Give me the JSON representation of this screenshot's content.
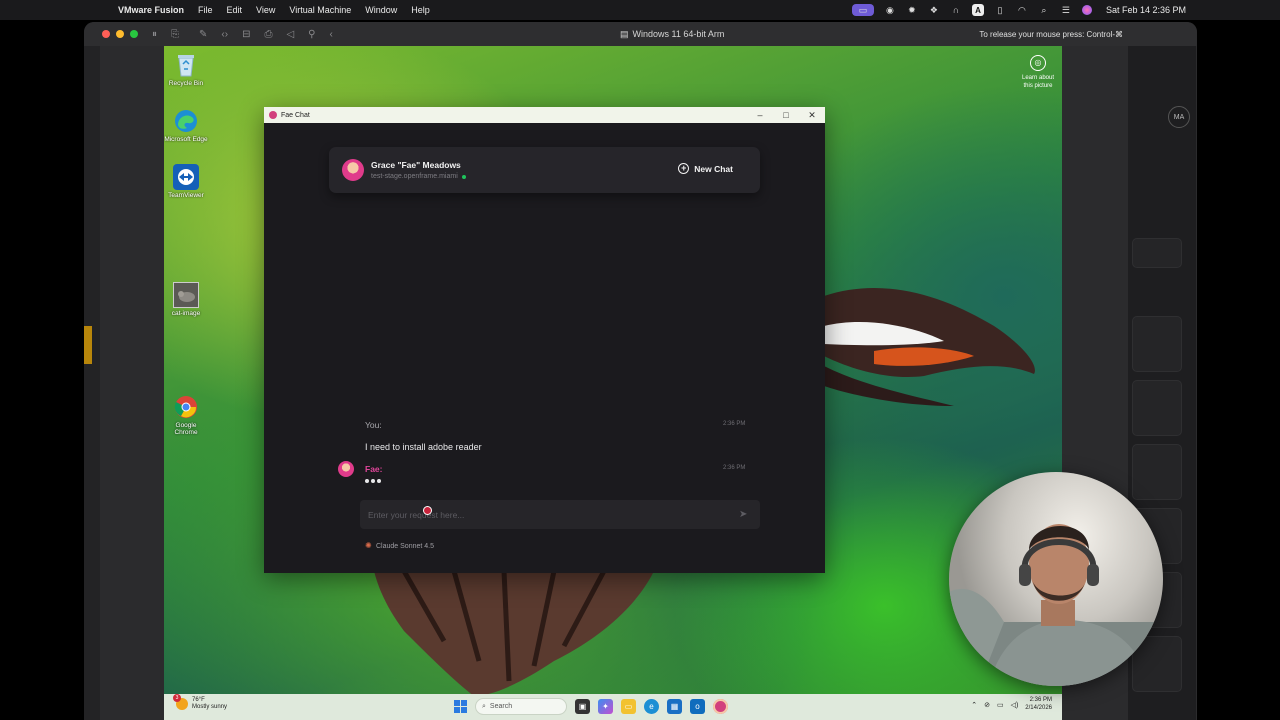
{
  "mac": {
    "app_name": "VMware Fusion",
    "menus": [
      "File",
      "Edit",
      "View",
      "Virtual Machine",
      "Window",
      "Help"
    ],
    "clock": "Sat Feb 14  2:36 PM",
    "status_badge_letter": "A"
  },
  "fusion": {
    "vm_title": "Windows 11 64-bit Arm",
    "release_hint": "To release your mouse press: Control-⌘",
    "ghost_avatar": "MA"
  },
  "desktop": {
    "icons": [
      {
        "label": "Recycle Bin",
        "icon": "recycle-bin-icon"
      },
      {
        "label": "Microsoft Edge",
        "icon": "edge-icon"
      },
      {
        "label": "TeamViewer",
        "icon": "teamviewer-icon"
      },
      {
        "label": "cat-image",
        "icon": "image-file-icon"
      },
      {
        "label": "Google Chrome",
        "icon": "chrome-icon"
      }
    ],
    "learn_line1": "Learn about",
    "learn_line2": "this picture"
  },
  "fae": {
    "window_title": "Fae Chat",
    "agent_name": "Grace \"Fae\" Meadows",
    "host": "test-stage.openframe.miami",
    "new_chat_label": "New Chat",
    "messages": [
      {
        "sender": "You:",
        "time": "2:36 PM",
        "text": "I need to install adobe reader"
      },
      {
        "sender": "Fae:",
        "time": "2:36 PM",
        "text": ""
      }
    ],
    "input_placeholder": "Enter your request here...",
    "model_label": "Claude Sonnet 4.5",
    "colors": {
      "accent": "#e0459a",
      "online": "#1ec35b"
    }
  },
  "taskbar": {
    "weather_temp": "76°F",
    "weather_desc": "Mostly sunny",
    "weather_badge": "3",
    "search_label": "Search",
    "time": "2:36 PM",
    "date": "2/14/2026"
  }
}
